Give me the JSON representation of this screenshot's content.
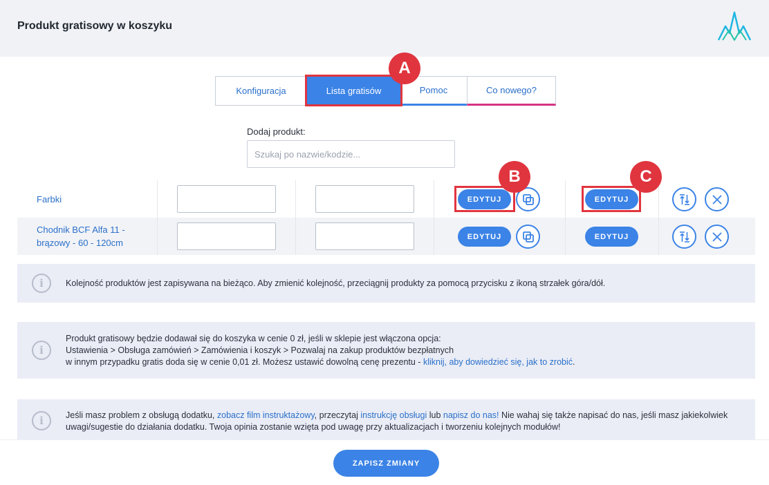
{
  "header": {
    "title": "Produkt gratisowy w koszyku",
    "logo": "app-logo-icon"
  },
  "tabs": [
    {
      "label": "Konfiguracja",
      "active": false
    },
    {
      "label": "Lista gratisów",
      "active": true
    },
    {
      "label": "Pomoc",
      "active": false
    },
    {
      "label": "Co nowego?",
      "active": false
    }
  ],
  "markers": {
    "a": "A",
    "b": "B",
    "c": "C"
  },
  "add_product": {
    "label": "Dodaj produkt:",
    "placeholder": "Szukaj po nazwie/kodzie..."
  },
  "products": [
    {
      "name": "Farbki",
      "edit1": "EDYTUJ",
      "edit2": "EDYTUJ"
    },
    {
      "name": "Chodnik BCF Alfa 11 - brązowy - 60 - 120cm",
      "edit1": "EDYTUJ",
      "edit2": "EDYTUJ"
    }
  ],
  "info1": {
    "text": "Kolejność produktów jest zapisywana na bieżąco. Aby zmienić kolejność, przeciągnij produkty za pomocą przycisku z ikoną strzałek góra/dół."
  },
  "info2": {
    "line1": "Produkt gratisowy będzie dodawał się do koszyka w cenie 0 zł, jeśli w sklepie jest włączona opcja:",
    "line2": "Ustawienia > Obsługa zamówień > Zamówienia i koszyk > Pozwalaj na zakup produktów bezpłatnych",
    "line3": "w innym przypadku gratis doda się w cenie 0,01 zł. Możesz ustawić dowolną cenę prezentu - ",
    "link": "kliknij, aby dowiedzieć się, jak to zrobić",
    "end": "."
  },
  "info3": {
    "t1": "Jeśli masz problem z obsługą dodatku, ",
    "l1": "zobacz film instruktażowy",
    "t2": ", przeczytaj ",
    "l2": "instrukcję obsługi",
    "t3": " lub ",
    "l3": "napisz do nas!",
    "t4": " Nie wahaj się także napisać do nas, jeśli masz jakiekolwiek uwagi/sugestie do działania dodatku. Twoja opinia zostanie wzięta pod uwagę przy aktualizacjach i tworzeniu kolejnych modułów!"
  },
  "info_icon": "i",
  "footer": {
    "save_label": "ZAPISZ ZMIANY"
  }
}
